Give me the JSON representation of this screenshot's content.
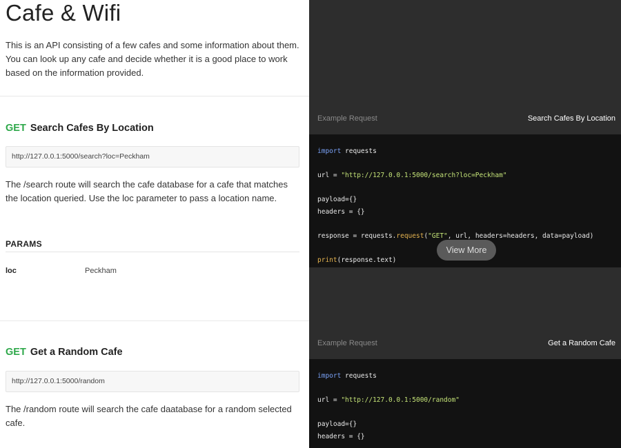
{
  "doc": {
    "title": "Cafe & Wifi",
    "intro": "This is an API consisting of a few cafes and some information about them. You can look up any cafe and decide whether it is a good place to work based on the information provided."
  },
  "endpoints": [
    {
      "method": "GET",
      "name": "Search Cafes By Location",
      "url": "http://127.0.0.1:5000/search?loc=Peckham",
      "description": "The /search route will search the cafe database for a cafe that matches the location queried. Use the loc parameter to pass a location name.",
      "params_title": "PARAMS",
      "params": [
        {
          "name": "loc",
          "value": "Peckham"
        }
      ]
    },
    {
      "method": "GET",
      "name": "Get a Random Cafe",
      "url": "http://127.0.0.1:5000/random",
      "description": "The /random route will search the cafe daatabase for a random selected cafe."
    }
  ],
  "examples": [
    {
      "label": "Example Request",
      "name": "Search Cafes By Location",
      "code": {
        "import_kw": "import",
        "import_mod": " requests",
        "url_prefix": "url = ",
        "url_str": "\"http://127.0.0.1:5000/search?loc=Peckham\"",
        "payload": "payload={}",
        "headers": "headers = {}",
        "resp_prefix": "response = requests.",
        "resp_fn": "request",
        "resp_open": "(",
        "resp_str": "\"GET\"",
        "resp_rest": ", url, headers=headers, data=payload)",
        "print_fn": "print",
        "print_rest": "(response.text)"
      },
      "view_more": "View More"
    },
    {
      "label": "Example Request",
      "name": "Get a Random Cafe",
      "code": {
        "import_kw": "import",
        "import_mod": " requests",
        "url_prefix": "url = ",
        "url_str": "\"http://127.0.0.1:5000/random\"",
        "payload": "payload={}",
        "headers": "headers = {}"
      }
    }
  ],
  "colors": {
    "method_get": "#2ea84a",
    "panel_bg": "#2d2d2d",
    "code_bg": "#121212"
  }
}
